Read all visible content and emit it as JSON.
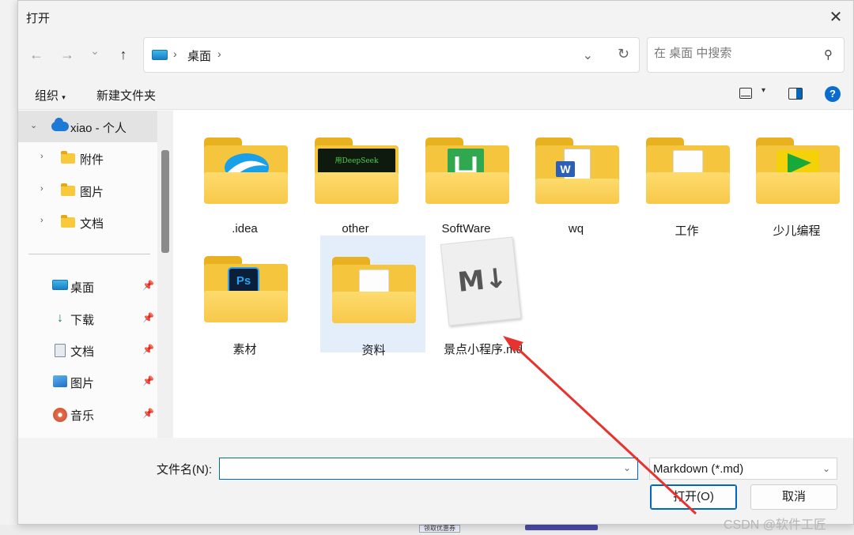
{
  "dialog": {
    "title": "打开",
    "close_glyph": "✕"
  },
  "nav": {
    "back": "←",
    "forward": "→",
    "recent": "⌄",
    "up": "↑",
    "breadcrumb": [
      "桌面"
    ],
    "search_placeholder": "在 桌面 中搜索"
  },
  "toolbar": {
    "organize": "组织",
    "new_folder": "新建文件夹",
    "help": "?"
  },
  "sidebar": {
    "onedrive": "xiao - 个人",
    "onedrive_children": [
      "附件",
      "图片",
      "文档"
    ],
    "quick_access": [
      {
        "label": "桌面",
        "icon": "desktop-icon"
      },
      {
        "label": "下载",
        "icon": "download-icon"
      },
      {
        "label": "文档",
        "icon": "document-icon"
      },
      {
        "label": "图片",
        "icon": "pictures-icon"
      },
      {
        "label": "音乐",
        "icon": "music-icon"
      }
    ]
  },
  "files": [
    {
      "name": ".idea",
      "type": "folder",
      "badge": "ide-logo-icon"
    },
    {
      "name": "other",
      "type": "folder",
      "badge": "deepseek-thumbnail",
      "badge_text": "用DeepSeek"
    },
    {
      "name": "SoftWare",
      "type": "folder",
      "badge": "green-app-icon"
    },
    {
      "name": "wq",
      "type": "folder",
      "badge": "word-doc-icon"
    },
    {
      "name": "工作",
      "type": "folder",
      "badge": "paper-icon"
    },
    {
      "name": "少儿编程",
      "type": "folder",
      "badge": "green-play-icon"
    },
    {
      "name": "素材",
      "type": "folder",
      "badge": "photoshop-icon"
    },
    {
      "name": "资料",
      "type": "folder",
      "badge": "paper-icon",
      "selected": true
    },
    {
      "name": "景点小程序.md",
      "type": "markdown-file"
    }
  ],
  "footer": {
    "filename_label": "文件名(N):",
    "filename_value": "",
    "filetype": "Markdown (*.md)",
    "open_button": "打开(O)",
    "cancel_button": "取消"
  },
  "watermark": "CSDN @软件工匠",
  "background": {
    "snippet": "领取优惠券"
  },
  "colors": {
    "accent": "#0067c0",
    "selection": "#e3eefa",
    "annotation_arrow": "#e8322d"
  }
}
